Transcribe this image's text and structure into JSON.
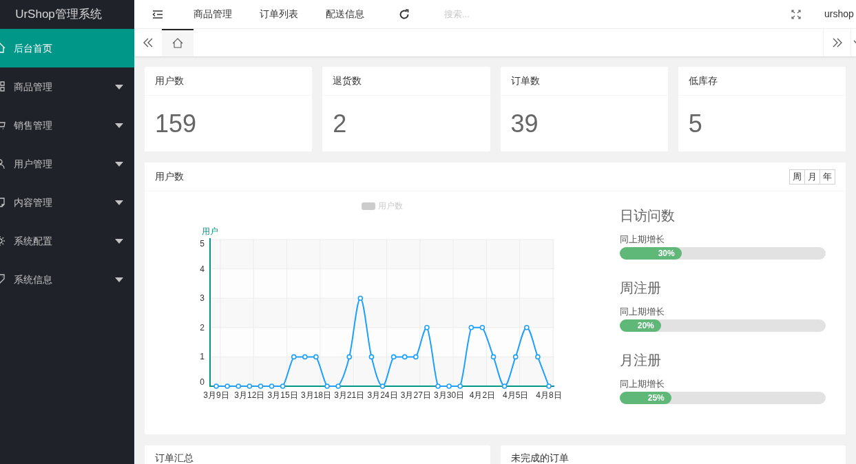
{
  "sidebar": {
    "logo": "UrShop管理系统",
    "items": [
      {
        "label": "后台首页",
        "selected": true,
        "has_submenu": false
      },
      {
        "label": "商品管理",
        "selected": false,
        "has_submenu": true
      },
      {
        "label": "销售管理",
        "selected": false,
        "has_submenu": true
      },
      {
        "label": "用户管理",
        "selected": false,
        "has_submenu": true
      },
      {
        "label": "内容管理",
        "selected": false,
        "has_submenu": true
      },
      {
        "label": "系统配置",
        "selected": false,
        "has_submenu": true
      },
      {
        "label": "系统信息",
        "selected": false,
        "has_submenu": true
      }
    ]
  },
  "topbar": {
    "links": [
      "商品管理",
      "订单列表",
      "配送信息"
    ],
    "search": {
      "placeholder": "搜索..."
    },
    "user": "urshop"
  },
  "stats": [
    {
      "title": "用户数",
      "value": "159"
    },
    {
      "title": "退货数",
      "value": "2"
    },
    {
      "title": "订单数",
      "value": "39"
    },
    {
      "title": "低库存",
      "value": "5"
    }
  ],
  "chart_card": {
    "title": "用户数",
    "periods": [
      {
        "label": "周",
        "selected": false
      },
      {
        "label": "月",
        "selected": false
      },
      {
        "label": "年",
        "selected": false
      }
    ],
    "chart_data": {
      "type": "line",
      "ylabel": "用户",
      "categories": [
        "3月9日",
        null,
        null,
        "3月12日",
        null,
        null,
        "3月15日",
        null,
        null,
        "3月18日",
        null,
        null,
        "3月21日",
        null,
        null,
        "3月24日",
        null,
        null,
        "3月27日",
        null,
        null,
        "3月30日",
        null,
        null,
        "4月2日",
        null,
        null,
        "4月5日",
        null,
        null,
        "4月8日"
      ],
      "grid": true,
      "series": [
        {
          "name": "用户数",
          "color": "#1e9fff",
          "marker": true,
          "values": [
            0,
            0,
            0,
            0,
            0,
            0,
            0,
            1,
            1,
            1,
            0,
            0,
            1,
            3,
            1,
            0,
            1,
            1,
            1,
            2,
            0,
            0,
            0,
            2,
            2,
            1,
            0,
            1,
            2,
            1,
            0
          ]
        }
      ],
      "ylim": [
        0,
        5
      ],
      "yticks": [
        0,
        1,
        2,
        3,
        4,
        5
      ]
    },
    "metrics": [
      {
        "title": "日访问数",
        "caption": "同上期增长",
        "level": 0.3,
        "reading": "30%"
      },
      {
        "title": "周注册",
        "caption": "同上期增长",
        "level": 0.2,
        "reading": "20%"
      },
      {
        "title": "月注册",
        "caption": "同上期增长",
        "level": 0.25,
        "reading": "25%"
      }
    ]
  },
  "bottom_cards": [
    {
      "title": "订单汇总"
    },
    {
      "title": "未完成的订单"
    }
  ]
}
